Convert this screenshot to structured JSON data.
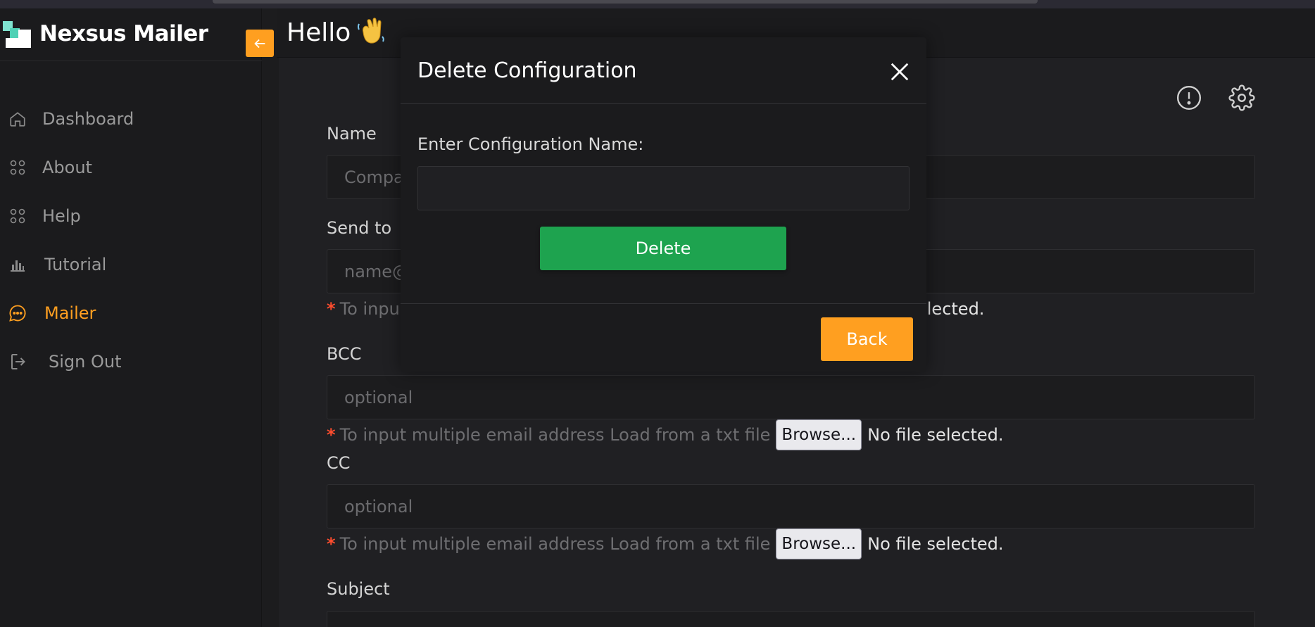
{
  "app": {
    "brand_name": "Nexsus Mailer",
    "accent_color": "#ff9f20",
    "success_color": "#1ea34f"
  },
  "sidebar": {
    "collapse_icon": "arrow-left-icon",
    "items": [
      {
        "label": "Dashboard",
        "icon": "home-icon",
        "active": false
      },
      {
        "label": "About",
        "icon": "grid-icon",
        "active": false
      },
      {
        "label": "Help",
        "icon": "grid-icon",
        "active": false
      },
      {
        "label": "Tutorial",
        "icon": "bar-chart-icon",
        "active": false
      },
      {
        "label": "Mailer",
        "icon": "chat-bubble-icon",
        "active": true
      },
      {
        "label": "Sign Out",
        "icon": "logout-icon",
        "active": false
      }
    ]
  },
  "header": {
    "greeting": "Hello",
    "greeting_icon": "waving-hand-icon"
  },
  "card": {
    "icons": [
      "info-icon",
      "gear-icon"
    ]
  },
  "form": {
    "name": {
      "label": "Name",
      "placeholder": "Compa"
    },
    "send_to": {
      "label": "Send to",
      "placeholder": "name@",
      "hint_end": "elected."
    },
    "bcc": {
      "label": "BCC",
      "placeholder": "optional",
      "hint": "To input multiple email address Load from a txt file",
      "browse": "Browse...",
      "nofile": "No file selected."
    },
    "cc": {
      "label": "CC",
      "placeholder": "optional",
      "hint": "To input multiple email address Load from a txt file",
      "browse": "Browse...",
      "nofile": "No file selected."
    },
    "subject": {
      "label": "Subject"
    }
  },
  "modal": {
    "title": "Delete Configuration",
    "input_label": "Enter Configuration Name:",
    "input_value": "",
    "delete_label": "Delete",
    "back_label": "Back",
    "close_icon": "close-icon"
  }
}
